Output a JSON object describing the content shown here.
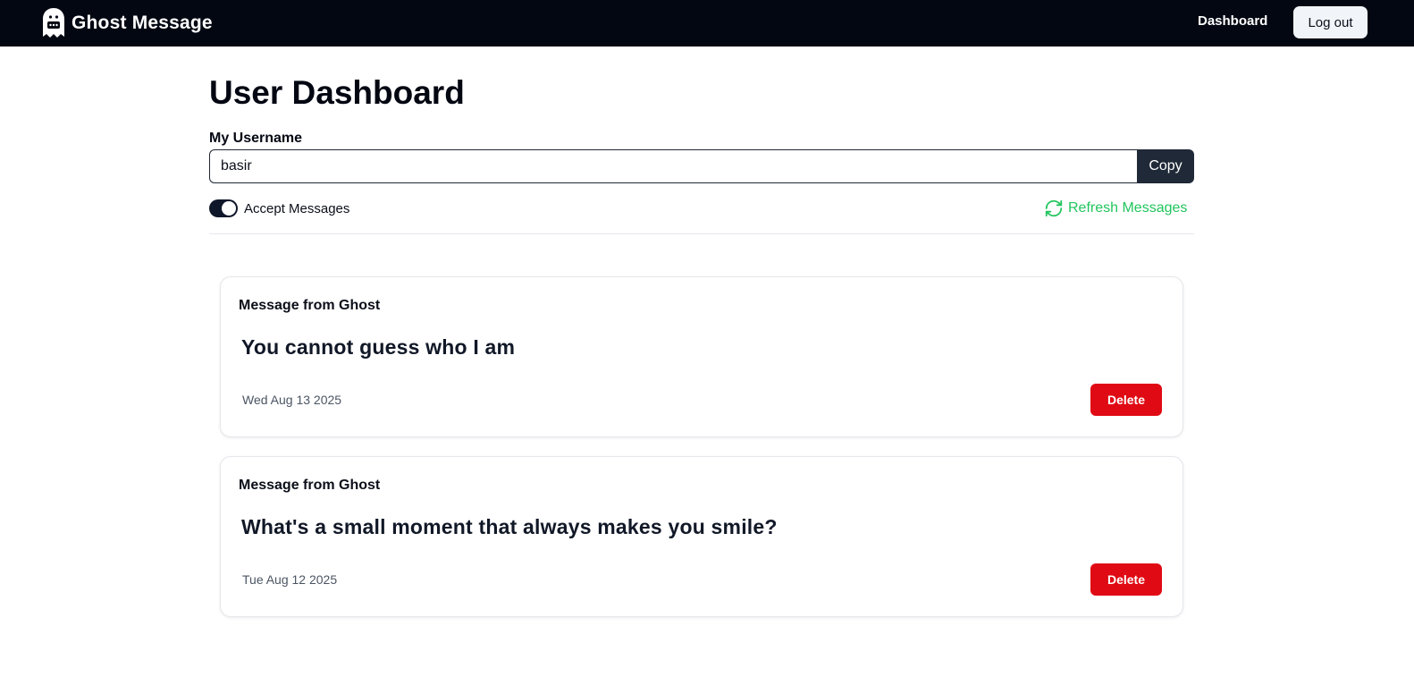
{
  "navbar": {
    "brand": "Ghost Message",
    "logo_icon": "ghost-icon",
    "dashboard_link": "Dashboard",
    "logout_label": "Log out"
  },
  "page": {
    "title": "User Dashboard"
  },
  "username": {
    "label": "My Username",
    "value": "basir",
    "copy_label": "Copy"
  },
  "accept_messages": {
    "label": "Accept Messages",
    "enabled": true
  },
  "refresh": {
    "label": "Refresh Messages",
    "icon": "refresh-icon"
  },
  "messages": [
    {
      "title": "Message from Ghost",
      "content": "You cannot guess who I am",
      "date": "Wed Aug 13 2025",
      "delete_label": "Delete"
    },
    {
      "title": "Message from Ghost",
      "content": "What's a small moment that always makes you smile?",
      "date": "Tue Aug 12 2025",
      "delete_label": "Delete"
    }
  ],
  "colors": {
    "navbar_bg": "#030712",
    "accent_green": "#22c55e",
    "delete_red": "#e00a14",
    "copy_bg": "#1f2937"
  }
}
